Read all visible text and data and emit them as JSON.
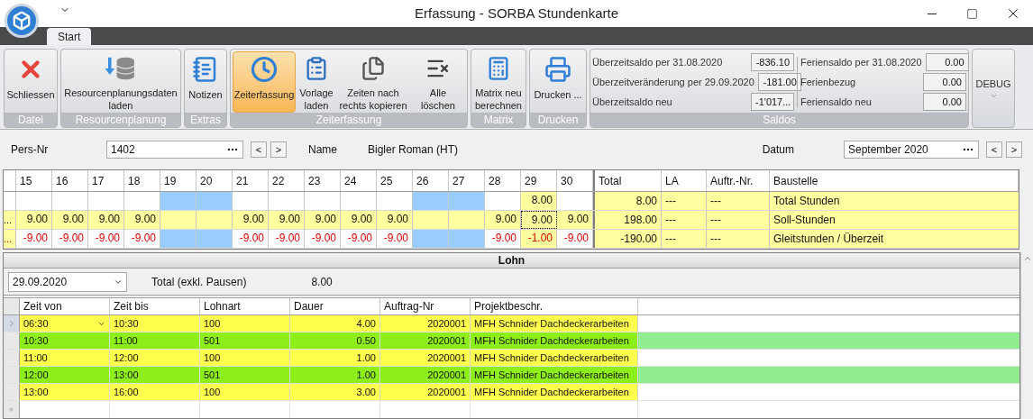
{
  "window": {
    "title": "Erfassung - SORBA Stundenkarte"
  },
  "tabs": [
    {
      "label": "Start",
      "selected": true
    }
  ],
  "ribbon": {
    "groups": [
      {
        "label": "Datei",
        "buttons": [
          {
            "label": "Schliessen",
            "selected": false
          }
        ]
      },
      {
        "label": "Resourcenplanung",
        "buttons": [
          {
            "label": "Resourcenplanungsdaten laden",
            "selected": false
          }
        ]
      },
      {
        "label": "Extras",
        "buttons": [
          {
            "label": "Notizen",
            "selected": false
          }
        ]
      },
      {
        "label": "Zeiterfassung",
        "buttons": [
          {
            "label": "Zeiterfassung",
            "selected": true
          },
          {
            "label": "Vorlage laden",
            "selected": false
          },
          {
            "label": "Zeiten nach rechts kopieren",
            "selected": false
          },
          {
            "label": "Alle löschen",
            "selected": false
          }
        ]
      },
      {
        "label": "Matrix",
        "buttons": [
          {
            "label": "Matrix neu berechnen",
            "selected": false
          }
        ]
      },
      {
        "label": "Drucken",
        "buttons": [
          {
            "label": "Drucken ...",
            "selected": false
          }
        ]
      }
    ],
    "saldos": {
      "label": "Saldos",
      "left": [
        {
          "label": "Überzeitsaldo per 31.08.2020",
          "value": "-836.10"
        },
        {
          "label": "Überzeitveränderung per 29.09.2020",
          "value": "-181.00"
        },
        {
          "label": "Überzeitsaldo neu",
          "value": "-1'017..."
        }
      ],
      "right": [
        {
          "label": "Feriensaldo per 31.08.2020",
          "value": "0.00"
        },
        {
          "label": "Ferienbezug",
          "value": "0.00"
        },
        {
          "label": "Feriensaldo neu",
          "value": "0.00"
        }
      ]
    },
    "debug": {
      "label": "DEBUG"
    }
  },
  "header": {
    "pers_label": "Pers-Nr",
    "pers_value": "1402",
    "name_label": "Name",
    "name_value": "Bigler Roman (HT)",
    "date_label": "Datum",
    "date_value": "September 2020",
    "prev": "<",
    "next": ">"
  },
  "matrix": {
    "days": [
      "15",
      "16",
      "17",
      "18",
      "19",
      "20",
      "21",
      "22",
      "23",
      "24",
      "25",
      "26",
      "27",
      "28",
      "29",
      "30"
    ],
    "columns": [
      "Total",
      "LA",
      "Auftr.-Nr.",
      "Baustelle"
    ],
    "rows": [
      {
        "kind": "sum",
        "lead": "",
        "total": "8.00",
        "la": "---",
        "order": "---",
        "site": "Total Stunden",
        "cells": [
          {
            "text": "",
            "color": "#ffffff",
            "focused": false
          },
          {
            "text": "",
            "color": "#ffffff",
            "focused": false
          },
          {
            "text": "",
            "color": "#ffffff",
            "focused": false
          },
          {
            "text": "",
            "color": "#ffffff",
            "focused": false
          },
          {
            "text": "",
            "color": "#99ccff",
            "focused": false
          },
          {
            "text": "",
            "color": "#99ccff",
            "focused": false
          },
          {
            "text": "",
            "color": "#ffffff",
            "focused": false
          },
          {
            "text": "",
            "color": "#ffffff",
            "focused": false
          },
          {
            "text": "",
            "color": "#ffffff",
            "focused": false
          },
          {
            "text": "",
            "color": "#ffffff",
            "focused": false
          },
          {
            "text": "",
            "color": "#ffffff",
            "focused": false
          },
          {
            "text": "",
            "color": "#99ccff",
            "focused": false
          },
          {
            "text": "",
            "color": "#99ccff",
            "focused": false
          },
          {
            "text": "",
            "color": "#ffffff",
            "focused": false
          },
          {
            "text": "8.00",
            "color": "#ffffa0",
            "focused": false
          },
          {
            "text": "",
            "color": "#ffffff",
            "focused": false
          }
        ]
      },
      {
        "kind": "target",
        "lead": "...",
        "total": "198.00",
        "la": "---",
        "order": "---",
        "site": "Soll-Stunden",
        "cells": [
          {
            "text": "9.00",
            "color": "#ffffa0",
            "focused": false
          },
          {
            "text": "9.00",
            "color": "#ffffa0",
            "focused": false
          },
          {
            "text": "9.00",
            "color": "#ffffa0",
            "focused": false
          },
          {
            "text": "9.00",
            "color": "#ffffa0",
            "focused": false
          },
          {
            "text": "",
            "color": "#ffffa0",
            "focused": false
          },
          {
            "text": "",
            "color": "#ffffa0",
            "focused": false
          },
          {
            "text": "9.00",
            "color": "#ffffa0",
            "focused": false
          },
          {
            "text": "9.00",
            "color": "#ffffa0",
            "focused": false
          },
          {
            "text": "9.00",
            "color": "#ffffa0",
            "focused": false
          },
          {
            "text": "9.00",
            "color": "#ffffa0",
            "focused": false
          },
          {
            "text": "9.00",
            "color": "#ffffa0",
            "focused": false
          },
          {
            "text": "",
            "color": "#ffffa0",
            "focused": false
          },
          {
            "text": "",
            "color": "#ffffa0",
            "focused": false
          },
          {
            "text": "9.00",
            "color": "#ffffa0",
            "focused": false
          },
          {
            "text": "9.00",
            "color": "#ffffa0",
            "focused": true
          },
          {
            "text": "9.00",
            "color": "#ffffa0",
            "focused": false
          }
        ]
      },
      {
        "kind": "balance",
        "lead": "...",
        "total": "-190.00",
        "la": "---",
        "order": "---",
        "site": "Gleitstunden / Überzeit",
        "cells": [
          {
            "text": "-9.00",
            "color": "#ffffff",
            "focused": false
          },
          {
            "text": "-9.00",
            "color": "#ffffff",
            "focused": false
          },
          {
            "text": "-9.00",
            "color": "#ffffff",
            "focused": false
          },
          {
            "text": "-9.00",
            "color": "#ffffff",
            "focused": false
          },
          {
            "text": "",
            "color": "#99ccff",
            "focused": false
          },
          {
            "text": "",
            "color": "#99ccff",
            "focused": false
          },
          {
            "text": "-9.00",
            "color": "#ffffff",
            "focused": false
          },
          {
            "text": "-9.00",
            "color": "#ffffff",
            "focused": false
          },
          {
            "text": "-9.00",
            "color": "#ffffff",
            "focused": false
          },
          {
            "text": "-9.00",
            "color": "#ffffff",
            "focused": false
          },
          {
            "text": "-9.00",
            "color": "#ffffff",
            "focused": false
          },
          {
            "text": "",
            "color": "#99ccff",
            "focused": false
          },
          {
            "text": "",
            "color": "#99ccff",
            "focused": false
          },
          {
            "text": "-9.00",
            "color": "#ffffff",
            "focused": false
          },
          {
            "text": "-1.00",
            "color": "#ffffa0",
            "focused": false
          },
          {
            "text": "-9.00",
            "color": "#ffffff",
            "focused": false
          }
        ]
      }
    ]
  },
  "lohn": {
    "title": "Lohn",
    "date": "29.09.2020",
    "total_label": "Total (exkl. Pausen)",
    "total_value": "8.00",
    "columns": [
      "Zeit von",
      "Zeit bis",
      "Lohnart",
      "Dauer",
      "Auftrag-Nr",
      "Projektbeschr."
    ],
    "rows": [
      {
        "von": "06:30",
        "bis": "10:30",
        "lohnart": "100",
        "dauer": "4.00",
        "auftrag": "2020001",
        "projekt": "MFH Schnider Dachdeckerarbeiten",
        "color": "#ffff4d",
        "kind": "work",
        "selected": true
      },
      {
        "von": "10:30",
        "bis": "11:00",
        "lohnart": "501",
        "dauer": "0.50",
        "auftrag": "2020001",
        "projekt": "MFH Schnider Dachdeckerarbeiten",
        "color": "#8eee1a",
        "kind": "break",
        "selected": false
      },
      {
        "von": "11:00",
        "bis": "12:00",
        "lohnart": "100",
        "dauer": "1.00",
        "auftrag": "2020001",
        "projekt": "MFH Schnider Dachdeckerarbeiten",
        "color": "#ffff4d",
        "kind": "work",
        "selected": false
      },
      {
        "von": "12:00",
        "bis": "13:00",
        "lohnart": "501",
        "dauer": "1.00",
        "auftrag": "2020001",
        "projekt": "MFH Schnider Dachdeckerarbeiten",
        "color": "#8eee1a",
        "kind": "break",
        "selected": false
      },
      {
        "von": "13:00",
        "bis": "16:00",
        "lohnart": "100",
        "dauer": "3.00",
        "auftrag": "2020001",
        "projekt": "MFH Schnider Dachdeckerarbeiten",
        "color": "#ffff4d",
        "kind": "work",
        "selected": false
      }
    ]
  }
}
